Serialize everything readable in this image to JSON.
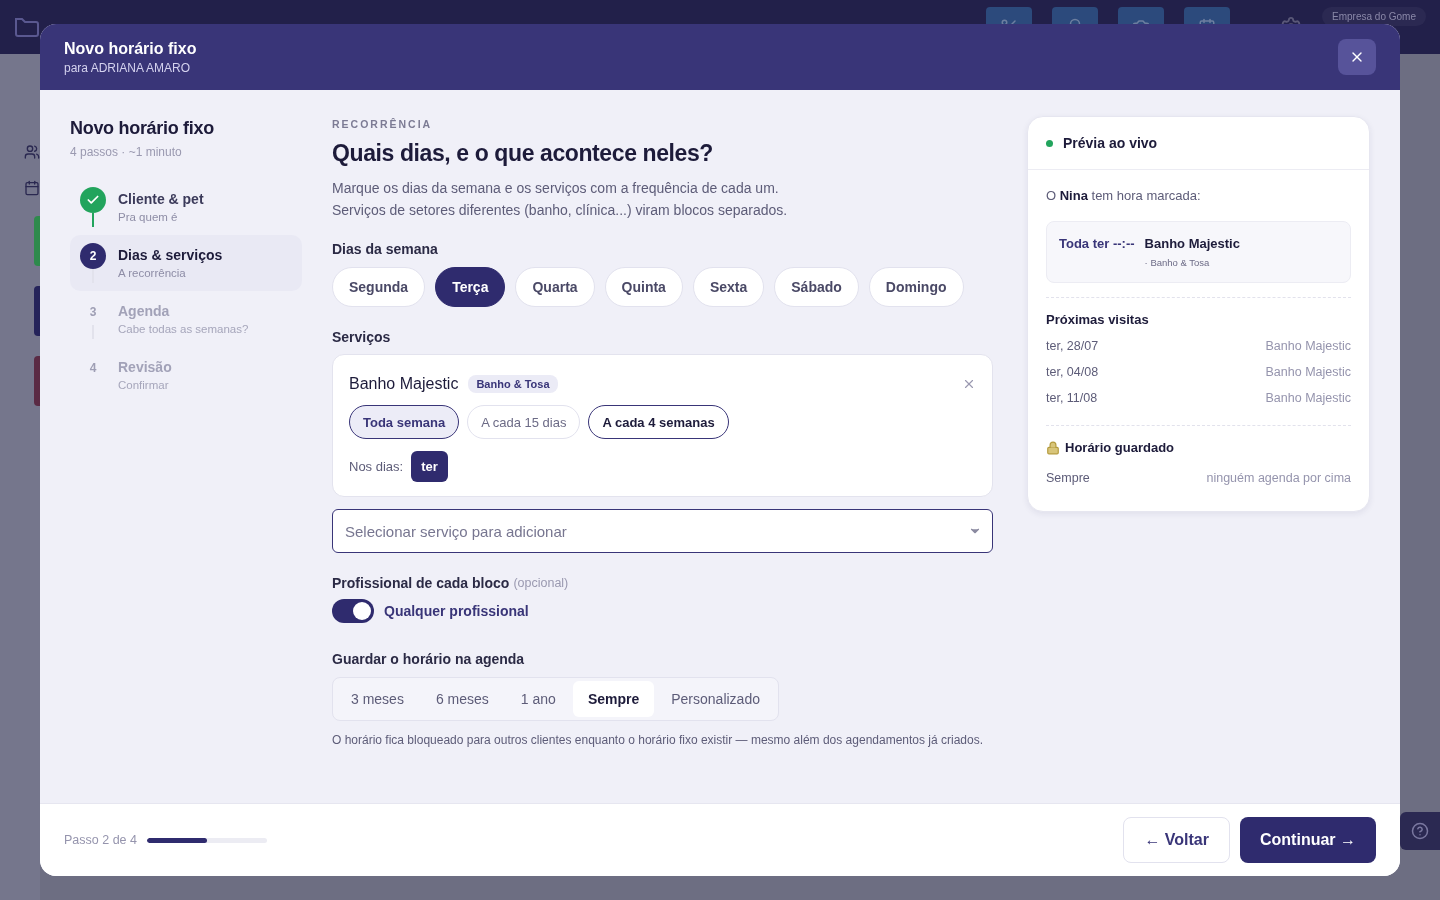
{
  "app": {
    "company": "Empresa do Gome"
  },
  "modal": {
    "title": "Novo horário fixo",
    "subtitle": "para ADRIANA AMARO"
  },
  "steps_panel": {
    "title": "Novo horário fixo",
    "meta": "4 passos · ~1 minuto",
    "steps": [
      {
        "title": "Cliente & pet",
        "subtitle": "Pra quem é",
        "completed": true,
        "selected": false
      },
      {
        "number": "2",
        "title": "Dias & serviços",
        "subtitle": "A recorrência",
        "completed": false,
        "selected": true
      },
      {
        "number": "3",
        "title": "Agenda",
        "subtitle": "Cabe todas as semanas?",
        "completed": false,
        "selected": false
      },
      {
        "number": "4",
        "title": "Revisão",
        "subtitle": "Confirmar",
        "completed": false,
        "selected": false
      }
    ]
  },
  "form": {
    "eyebrow": "RECORRÊNCIA",
    "heading": "Quais dias, e o que acontece neles?",
    "description": [
      "Marque os dias da semana e os serviços com a frequência de cada um.",
      "Serviços de setores diferentes (banho, clínica...) viram blocos separados."
    ],
    "days_label": "Dias da semana",
    "days": [
      {
        "label": "Segunda",
        "selected": false
      },
      {
        "label": "Terça",
        "selected": true
      },
      {
        "label": "Quarta",
        "selected": false
      },
      {
        "label": "Quinta",
        "selected": false
      },
      {
        "label": "Sexta",
        "selected": false
      },
      {
        "label": "Sábado",
        "selected": false
      },
      {
        "label": "Domingo",
        "selected": false
      }
    ],
    "services_label": "Serviços",
    "service": {
      "name": "Banho Majestic",
      "tag": "Banho & Tosa",
      "frequencies": [
        {
          "label": "Toda semana",
          "selected": true,
          "focused": false
        },
        {
          "label": "A cada 15 dias",
          "selected": false,
          "focused": false
        },
        {
          "label": "A cada 4 semanas",
          "selected": false,
          "focused": true
        }
      ],
      "days_label": "Nos dias:",
      "days": [
        "ter"
      ]
    },
    "service_select": {
      "placeholder": "Selecionar serviço para adicionar"
    },
    "professional_label": "Profissional de cada bloco",
    "professional_hint": "(opcional)",
    "professional_toggle": {
      "on": true,
      "label": "Qualquer profissional"
    },
    "storage_label": "Guardar o horário na agenda",
    "storage_options": [
      {
        "label": "3 meses",
        "selected": false
      },
      {
        "label": "6 meses",
        "selected": false
      },
      {
        "label": "1 ano",
        "selected": false
      },
      {
        "label": "Sempre",
        "selected": true
      },
      {
        "label": "Personalizado",
        "selected": false
      }
    ],
    "storage_note": "O horário fica bloqueado para outros clientes enquanto o horário fixo existir — mesmo além dos agendamentos já criados."
  },
  "preview": {
    "title": "Prévia ao vivo",
    "color": "#22a45d",
    "intro": "O **Nina** tem hora marcada:",
    "block": {
      "when": "Toda ter --:--",
      "service": "Banho Majestic",
      "category": "· Banho & Tosa"
    },
    "next_title": "Próximas visitas",
    "visits": [
      {
        "date": "ter, 28/07",
        "service": "Banho Majestic"
      },
      {
        "date": "ter, 04/08",
        "service": "Banho Majestic"
      },
      {
        "date": "ter, 11/08",
        "service": "Banho Majestic"
      }
    ],
    "guard_title": "Horário guardado",
    "guard_label": "Sempre",
    "guard_value": "ninguém agenda por cima"
  },
  "footer": {
    "step_text": "Passo 2 de 4",
    "level": 0.5,
    "back": "← Voltar",
    "next": "Continuar →"
  }
}
